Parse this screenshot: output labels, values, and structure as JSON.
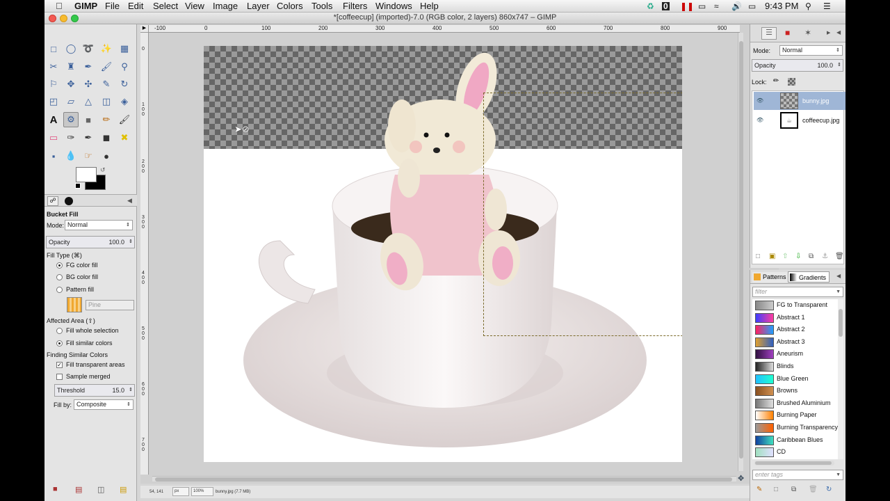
{
  "menubar": {
    "items": [
      "GIMP",
      "File",
      "Edit",
      "Select",
      "View",
      "Image",
      "Layer",
      "Colors",
      "Tools",
      "Filters",
      "Windows",
      "Help"
    ],
    "clock": "9:43 PM"
  },
  "window": {
    "title": "*[coffeecup] (imported)-7.0 (RGB color, 2 layers) 860x747 – GIMP"
  },
  "ruler": {
    "top_labels": [
      "-100",
      "0",
      "100",
      "200",
      "300",
      "400",
      "500",
      "600",
      "700",
      "800",
      "900"
    ],
    "left_labels": [
      "0",
      "1 0 0",
      "2 0 0",
      "3 0 0",
      "4 0 0",
      "5 0 0",
      "6 0 0",
      "7 0 0"
    ]
  },
  "tool_options": {
    "title": "Bucket Fill",
    "mode_label": "Mode:",
    "mode_value": "Normal",
    "opacity_label": "Opacity",
    "opacity_value": "100.0",
    "fill_type_label": "Fill Type  (⌘)",
    "fill_types": [
      "FG color fill",
      "BG color fill",
      "Pattern fill"
    ],
    "pattern_name": "Pine",
    "affected_area_label": "Affected Area  (⇧)",
    "affected_areas": [
      "Fill whole selection",
      "Fill similar colors"
    ],
    "finding_label": "Finding Similar Colors",
    "fill_transparent": "Fill transparent areas",
    "sample_merged": "Sample merged",
    "threshold_label": "Threshold",
    "threshold_value": "15.0",
    "fill_by_label": "Fill by:",
    "fill_by_value": "Composite"
  },
  "layers": {
    "mode_label": "Mode:",
    "mode_value": "Normal",
    "opacity_label": "Opacity",
    "opacity_value": "100.0",
    "lock_label": "Lock:",
    "items": [
      "bunny.jpg",
      "coffeecup.jpg"
    ]
  },
  "gradients": {
    "tabs": [
      "Patterns",
      "Gradients"
    ],
    "filter_placeholder": "filter",
    "tags_placeholder": "enter tags",
    "items": [
      {
        "name": "FG to Transparent",
        "colors": [
          "#888888",
          "#cccccc"
        ]
      },
      {
        "name": "Abstract 1",
        "colors": [
          "#3d3dff",
          "#ff3d9e"
        ]
      },
      {
        "name": "Abstract 2",
        "colors": [
          "#ff2060",
          "#20a0ff"
        ]
      },
      {
        "name": "Abstract 3",
        "colors": [
          "#e0a030",
          "#3060c0"
        ]
      },
      {
        "name": "Aneurism",
        "colors": [
          "#301040",
          "#a040c0"
        ]
      },
      {
        "name": "Blinds",
        "colors": [
          "#222222",
          "#dddddd"
        ]
      },
      {
        "name": "Blue Green",
        "colors": [
          "#20c0ff",
          "#20ffd0"
        ]
      },
      {
        "name": "Browns",
        "colors": [
          "#8a5020",
          "#d09050"
        ]
      },
      {
        "name": "Brushed Aluminium",
        "colors": [
          "#777777",
          "#e0e0e0"
        ]
      },
      {
        "name": "Burning Paper",
        "colors": [
          "#ffffff",
          "#ff8000"
        ]
      },
      {
        "name": "Burning Transparency",
        "colors": [
          "#999999",
          "#ff6000"
        ]
      },
      {
        "name": "Caribbean Blues",
        "colors": [
          "#1040a0",
          "#40e0c0"
        ]
      },
      {
        "name": "CD",
        "colors": [
          "#a0e0c0",
          "#e0e0ff"
        ]
      }
    ]
  },
  "status": {
    "coords": "54, 141",
    "unit": "px",
    "zoom": "100%",
    "file_info": "bunny.jpg (7.7 MB)"
  },
  "colors": {
    "selected_layer": "#9fb6d6",
    "accent": "#3a5f9a"
  }
}
